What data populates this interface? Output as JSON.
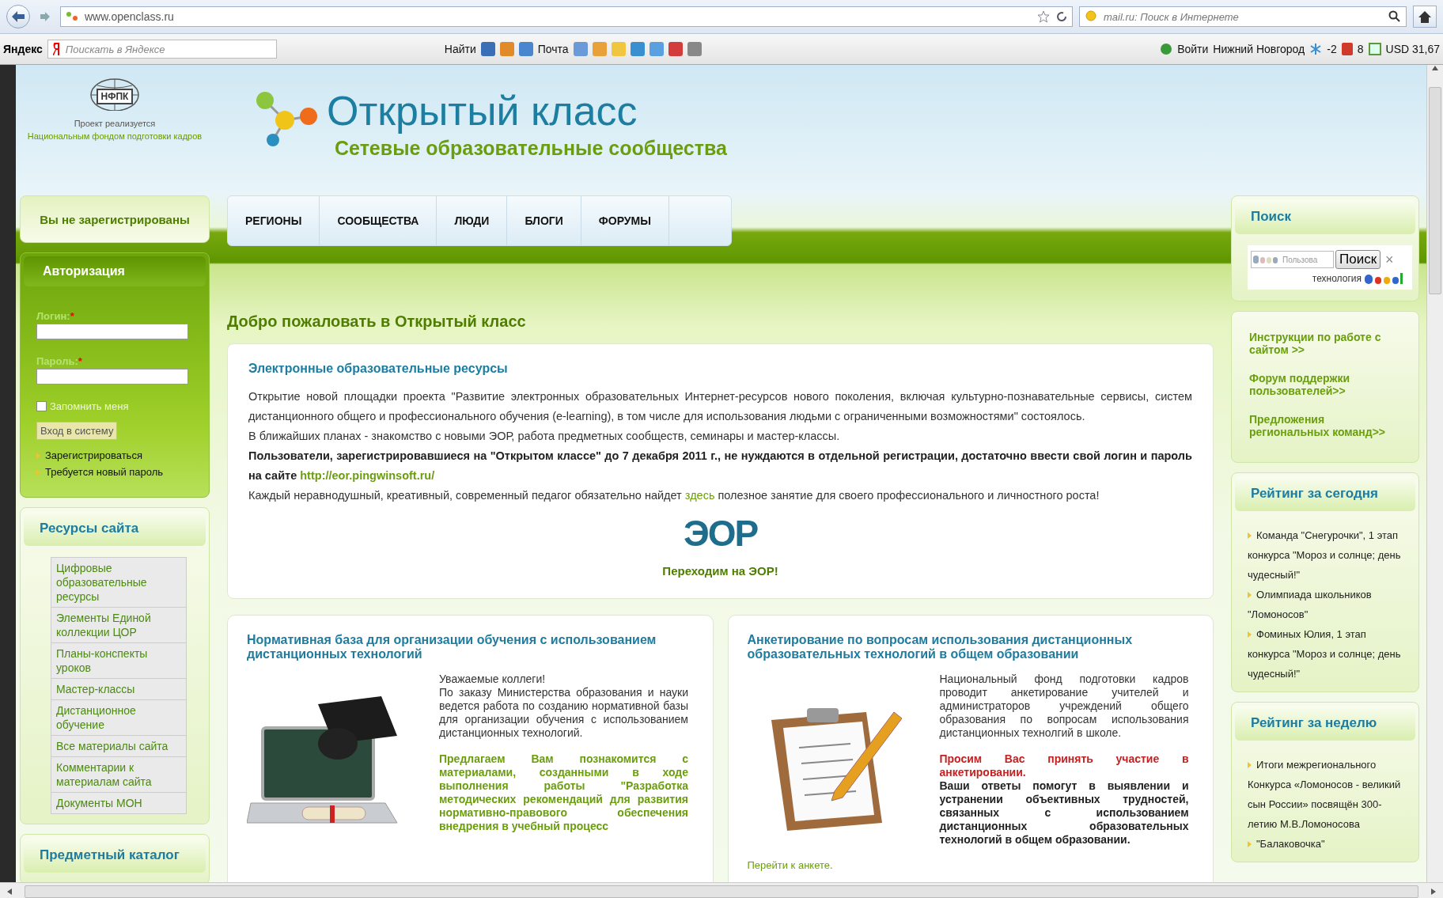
{
  "browser": {
    "url": "www.openclass.ru",
    "search_placeholder": "mail.ru: Поиск в Интернете"
  },
  "yandex_bar": {
    "logo": "Яндекс",
    "placeholder": "Поискать в Яндексе",
    "find": "Найти",
    "mail": "Почта",
    "login": "Войти",
    "city": "Нижний Новгород",
    "temperature": "-2",
    "count": "8",
    "currency": "USD 31,67"
  },
  "header": {
    "partner_logo": "НФПК",
    "partner_caption": "Проект реализуется",
    "partner_name": "Национальным фондом подготовки кадров",
    "title": "Открытый класс",
    "subtitle": "Сетевые образовательные сообщества"
  },
  "nav": [
    {
      "label": "РЕГИОНЫ",
      "selected": false
    },
    {
      "label": "СООБЩЕСТВА",
      "selected": false
    },
    {
      "label": "ЛЮДИ",
      "selected": false
    },
    {
      "label": "БЛОГИ",
      "selected": false
    },
    {
      "label": "ФОРУМЫ",
      "selected": false
    }
  ],
  "left": {
    "status": "Вы не зарегистрированы",
    "auth": {
      "title": "Авторизация",
      "login_label": "Логин:",
      "password_label": "Пароль:",
      "required": "*",
      "remember": {
        "label": "Запомнить меня",
        "checked": false
      },
      "submit": "Вход в систему",
      "links": [
        "Зарегистрироваться",
        "Требуется новый пароль"
      ]
    },
    "resources": {
      "title": "Ресурсы сайта",
      "items": [
        "Цифровые образовательные ресурсы",
        "Элементы Единой коллекции ЦОР",
        "Планы-конспекты уроков",
        "Мастер-классы",
        "Дистанционное обучение",
        "Все материалы сайта",
        "Комментарии к материалам сайта",
        "Документы МОН"
      ]
    },
    "catalog": {
      "title": "Предметный каталог"
    }
  },
  "main": {
    "heading": "Добро пожаловать в Открытый класс",
    "feature": {
      "title": "Электронные образовательные ресурсы",
      "paragraphs": [
        {
          "kind": "normal",
          "text": "Открытие новой площадки проекта \"Развитие электронных образовательных Интернет-ресурсов нового поколения, включая культурно-познавательные сервисы, систем дистанционного общего и профессионального обучения (e-learning), в том числе для использования людьми с ограниченными возможностями\" состоялось."
        },
        {
          "kind": "normal",
          "text": "В ближайших планах - знакомство с новыми ЭОР, работа предметных сообществ, семинары и мастер-классы."
        },
        {
          "kind": "bold",
          "text": "Пользователи, зарегистрировавшиеся на \"Открытом классе\" до 7 декабря 2011 г., не нуждаются в отдельной регистрации, достаточно ввести свой логин и пароль на сайте ",
          "link": "http://eor.pingwinsoft.ru/"
        },
        {
          "kind": "normal",
          "text": "Каждый неравнодушный, креативный, современный педагог обязательно найдет ",
          "link": "здесь",
          "rest": " полезное занятие для своего профессионального и личностного роста!"
        }
      ],
      "logo": "ЭОР",
      "cta": "Переходим на ЭОР!"
    },
    "cards": [
      {
        "title": "Нормативная база для организации обучения с использованием дистанционных технологий",
        "kind": "laptop",
        "paragraphs": [
          {
            "kind": "normal",
            "text": "Уважаемые коллеги!"
          },
          {
            "kind": "normal",
            "text": "По заказу Министерства образования и науки ведется работа по созданию нормативной базы для организации обучения с использованием дистанционных технологий."
          },
          {
            "kind": "green",
            "text": "Предлагаем Вам познакомится с материалами, созданными в ходе выполнения работы \"Разработка методических рекомендаций для развития нормативно-правового обеспечения внедрения в учебный процесс"
          }
        ]
      },
      {
        "title": "Анкетирование по вопросам использования дистанционных образовательных технологий в общем образовании",
        "kind": "clipboard",
        "paragraphs": [
          {
            "kind": "normal",
            "text": "Национальный фонд подготовки кадров проводит анкетирование учителей и администраторов учреждений общего образования по вопросам использования дистанционных технолгий в школе."
          },
          {
            "kind": "red",
            "text": "Просим Вас принять участие в анкетировании."
          },
          {
            "kind": "bold",
            "text": "Ваши ответы помогут в выявлении и устранении объективных трудностей, связанных с использованием дистанционных образовательных технологий в общем образовании."
          }
        ],
        "link": "Перейти к анкете."
      }
    ]
  },
  "right": {
    "search": {
      "title": "Поиск",
      "placeholder": "Пользова",
      "button": "Поиск",
      "clear": "×",
      "powered": "технология"
    },
    "links": [
      "Инструкции по работе с сайтом >>",
      "Форум поддержки пользователей>>",
      "Предложения региональных команд>>"
    ],
    "rating_today": {
      "title": "Рейтинг за сегодня",
      "items": [
        "Команда \"Снегурочки\", 1 этап конкурса \"Мороз и солнце; день чудесный!\"",
        "Олимпиада школьников \"Ломоносов\"",
        "Фоминых Юлия, 1 этап конкурса \"Мороз и солнце; день чудесный!\""
      ]
    },
    "rating_week": {
      "title": "Рейтинг за неделю",
      "items": [
        "Итоги межрегионального Конкурса «Ломоносов - великий сын России» посвящён 300-летию М.В.Ломоносова",
        "\"Балаковочка\""
      ]
    }
  }
}
